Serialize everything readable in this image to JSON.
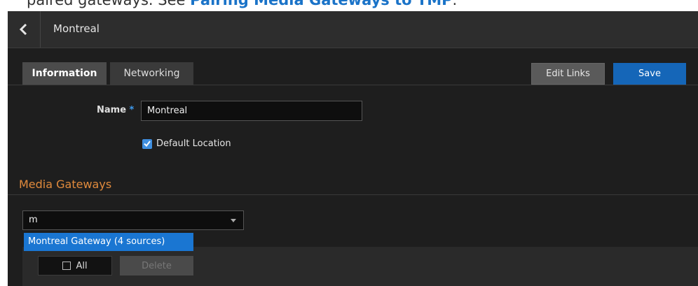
{
  "doc": {
    "prefix": "paired gateways. See ",
    "link": "Pairing Media Gateways to TMP",
    "suffix": "."
  },
  "header": {
    "title": "Montreal",
    "back_icon": "chevron-left-icon"
  },
  "tabs": [
    {
      "label": "Information",
      "active": true
    },
    {
      "label": "Networking",
      "active": false
    }
  ],
  "toolbar": {
    "edit_links_label": "Edit Links",
    "save_label": "Save"
  },
  "form": {
    "name_label": "Name",
    "required_marker": "*",
    "name_value": "Montreal",
    "default_location_label": "Default Location",
    "default_location_checked": true
  },
  "media_gateways": {
    "section_title": "Media Gateways",
    "select_value": "m",
    "dropdown_option": "Montreal Gateway (4 sources)",
    "all_label": "All",
    "delete_label": "Delete"
  },
  "colors": {
    "accent": "#1566b8",
    "section_title": "#e08a3c",
    "background": "#1e1e1e"
  }
}
